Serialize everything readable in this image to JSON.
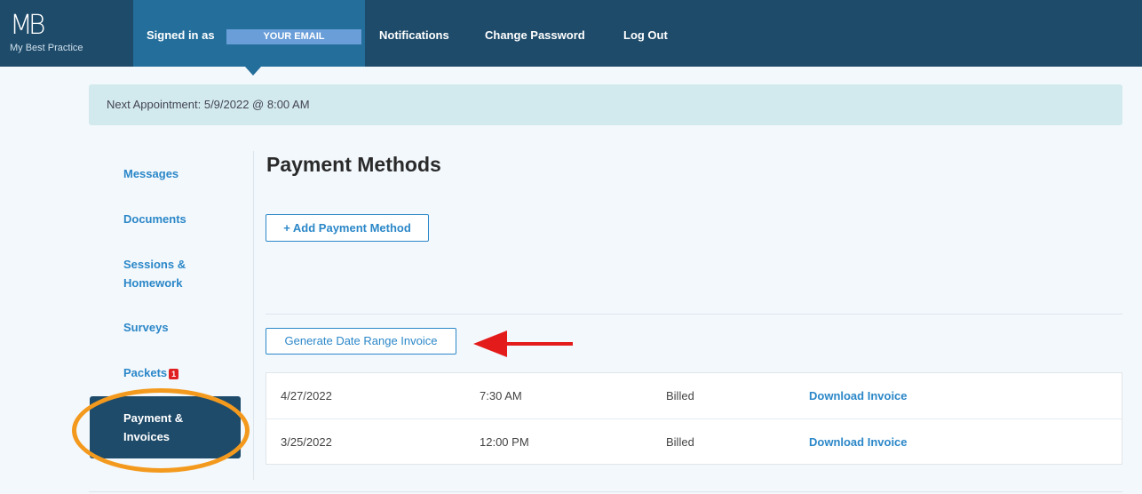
{
  "header": {
    "logo_mark": "MB",
    "logo_text": "My Best Practice",
    "signed_in_label": "Signed in as",
    "email_redaction": "YOUR EMAIL",
    "nav": {
      "notifications": "Notifications",
      "change_password": "Change Password",
      "logout": "Log Out"
    }
  },
  "banner": {
    "text": "Next Appointment: 5/9/2022 @ 8:00 AM"
  },
  "sidebar": {
    "items": [
      {
        "label": "Messages"
      },
      {
        "label": "Documents"
      },
      {
        "label": "Sessions & Homework"
      },
      {
        "label": "Surveys"
      },
      {
        "label": "Packets",
        "badge": "1"
      }
    ],
    "active": {
      "label": "Payment & Invoices"
    }
  },
  "main": {
    "title": "Payment Methods",
    "add_button": "+ Add Payment Method",
    "generate_button": "Generate Date Range Invoice",
    "invoices": [
      {
        "date": "4/27/2022",
        "time": "7:30 AM",
        "status": "Billed",
        "link": "Download Invoice"
      },
      {
        "date": "3/25/2022",
        "time": "12:00 PM",
        "status": "Billed",
        "link": "Download Invoice"
      }
    ]
  },
  "annotations": {
    "arrow_color": "#e41b1b",
    "oval_color": "#f39a1e"
  },
  "colors": {
    "header_bg": "#1e4b6a",
    "accent": "#2b87c8",
    "banner_bg": "#d2eaed"
  }
}
